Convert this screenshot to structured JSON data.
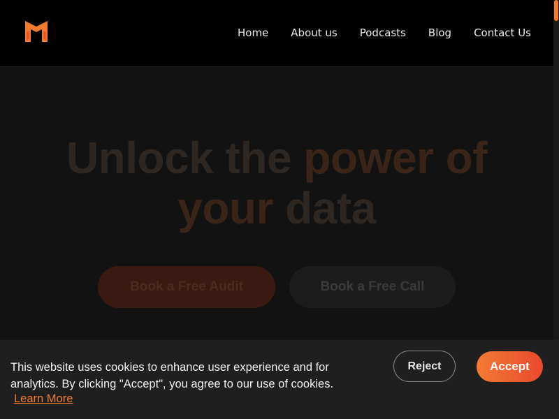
{
  "nav": {
    "items": [
      {
        "label": "Home"
      },
      {
        "label": "About us"
      },
      {
        "label": "Podcasts"
      },
      {
        "label": "Blog"
      },
      {
        "label": "Contact Us"
      }
    ]
  },
  "logo": {
    "icon": "m-logo-icon"
  },
  "hero": {
    "title_part1": "Unlock the",
    "title_accent1": "power of",
    "title_accent2": "your",
    "title_part2": "data",
    "primary_button": "Book a Free Audit",
    "secondary_button": "Book a Free Call"
  },
  "cookie": {
    "message": "This website uses cookies to enhance user experience and for analytics. By clicking \"Accept\", you agree to our use of cookies.",
    "learn_more": "Learn More",
    "reject_label": "Reject",
    "accept_label": "Accept"
  },
  "colors": {
    "accent": "#f07a30",
    "background": "#000000",
    "banner": "#1f1f1f"
  }
}
